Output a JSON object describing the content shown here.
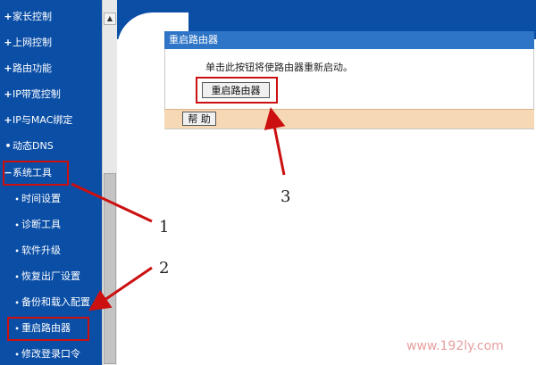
{
  "sidebar": {
    "items": [
      {
        "label": "家长控制",
        "level": "top",
        "bullet": "+"
      },
      {
        "label": "上网控制",
        "level": "top",
        "bullet": "+"
      },
      {
        "label": "路由功能",
        "level": "top",
        "bullet": "+"
      },
      {
        "label": "IP带宽控制",
        "level": "top",
        "bullet": "+"
      },
      {
        "label": "IP与MAC绑定",
        "level": "top",
        "bullet": "+"
      },
      {
        "label": "动态DNS",
        "level": "top",
        "bullet": "•"
      },
      {
        "label": "系统工具",
        "level": "top",
        "bullet": "−",
        "highlighted": true
      },
      {
        "label": "时间设置",
        "level": "sub",
        "bullet": "•"
      },
      {
        "label": "诊断工具",
        "level": "sub",
        "bullet": "•"
      },
      {
        "label": "软件升级",
        "level": "sub",
        "bullet": "•"
      },
      {
        "label": "恢复出厂设置",
        "level": "sub",
        "bullet": "•"
      },
      {
        "label": "备份和载入配置",
        "level": "sub",
        "bullet": "•"
      },
      {
        "label": "重启路由器",
        "level": "sub",
        "bullet": "•",
        "highlighted": true
      },
      {
        "label": "修改登录口令",
        "level": "sub",
        "bullet": "•"
      }
    ]
  },
  "panel": {
    "title": "重启路由器",
    "description": "单击此按钮将使路由器重新启动。",
    "reboot_button": "重启路由器",
    "help_button": "帮 助"
  },
  "annotations": {
    "callout_1": "1",
    "callout_2": "2",
    "callout_3": "3"
  },
  "watermark": "www.192ly.com",
  "colors": {
    "sidebar_bg": "#0a4ea6",
    "panel_header": "#2f75c7",
    "help_bar": "#f6d8b4",
    "annotation_red": "#cc1010"
  },
  "icons": {
    "scroll_up": "scroll-up-arrow-icon"
  }
}
